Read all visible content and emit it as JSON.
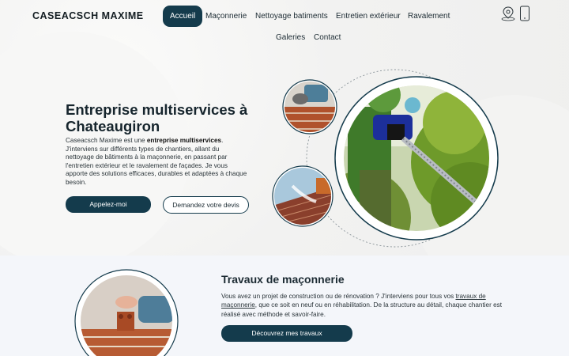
{
  "brand": {
    "logo_text": "CASEACSCH MAXIME"
  },
  "nav": {
    "items": [
      {
        "label": "Accueil",
        "active": true
      },
      {
        "label": "Maçonnerie"
      },
      {
        "label": "Nettoyage batiments"
      },
      {
        "label": "Entretien extérieur"
      },
      {
        "label": "Ravalement"
      },
      {
        "label": "Galeries"
      },
      {
        "label": "Contact"
      }
    ],
    "icons": [
      "location-pin-icon",
      "mobile-phone-icon"
    ]
  },
  "hero": {
    "title_line1": "Entreprise multiservices à",
    "title_line2": "Chateaugiron",
    "text_intro": "Caseacsch Maxime est une ",
    "text_bold": "entreprise multiservices",
    "text_rest": ". J'interviens sur différents types de chantiers, allant du nettoyage de bâtiments à la maçonnerie, en passant par l'entretien extérieur et le ravalement de façades. Je vous apporte des solutions efficaces, durables et adaptées à chaque besoin.",
    "call_button": "Appelez-moi",
    "quote_button": "Demandez votre devis"
  },
  "masonry": {
    "title": "Travaux de maçonnerie",
    "text_before": "Vous avez un projet de construction ou de rénovation ? J'interviens pour tous vos ",
    "text_link": "travaux de maçonnerie",
    "text_after": ", que ce soit en neuf ou en réhabilitation. De la structure au détail, chaque chantier est réalisé avec méthode et savoir-faire.",
    "button": "Découvrez mes travaux"
  },
  "colors": {
    "primary": "#143b4c",
    "background": "#f5f5f4",
    "section_bg": "#f4f6fa"
  }
}
